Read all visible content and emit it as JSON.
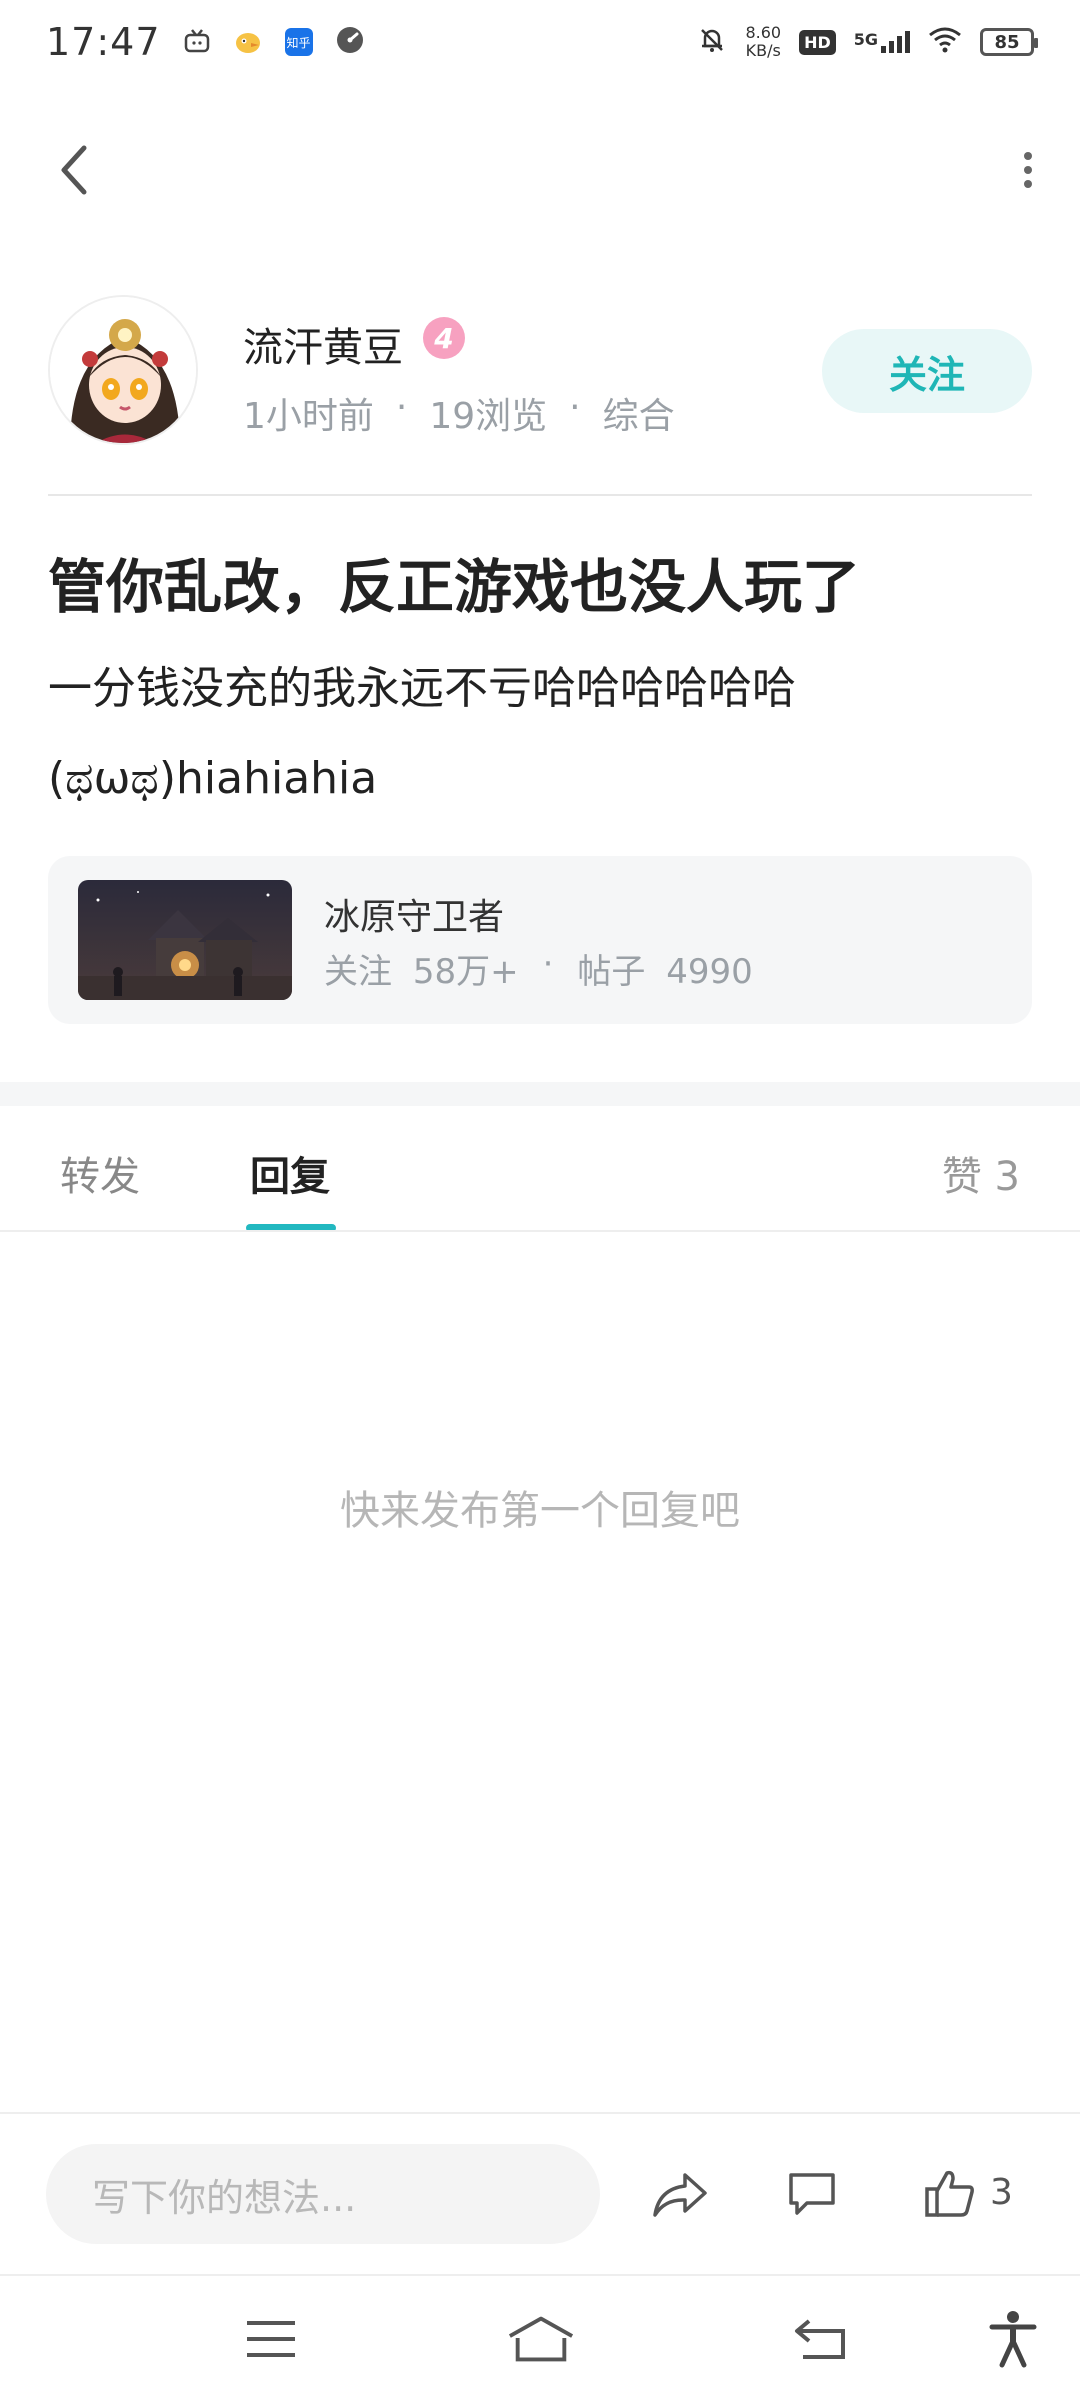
{
  "status_bar": {
    "time": "17:47",
    "net_speed_value": "8.60",
    "net_speed_unit": "KB/s",
    "hd_label": "HD",
    "signal_label": "5G",
    "battery": "85",
    "app_icon_zhihu": "知乎"
  },
  "post": {
    "author": "流汗黄豆",
    "level": "4",
    "time_ago": "1小时前",
    "sep": "·",
    "views": "19浏览",
    "category": "综合",
    "follow_label": "关注",
    "title": "管你乱改，反正游戏也没人玩了",
    "body_line1": "一分钱没充的我永远不亏哈哈哈哈哈哈",
    "body_line2": "(ಥωಥ)hiahiahia"
  },
  "game_card": {
    "name": "冰原守卫者",
    "followers_label": "关注",
    "followers_value": "58万+",
    "sep": "·",
    "posts_label": "帖子",
    "posts_value": "4990"
  },
  "tabs": {
    "repost": "转发",
    "reply": "回复",
    "likes": "赞 3"
  },
  "empty_state": "快来发布第一个回复吧",
  "action_bar": {
    "input_placeholder": "写下你的想法...",
    "like_count": "3"
  },
  "colors": {
    "accent": "#22b8c0",
    "follow_bg": "#e8f7f7",
    "level_badge": "#f7a1c0"
  }
}
